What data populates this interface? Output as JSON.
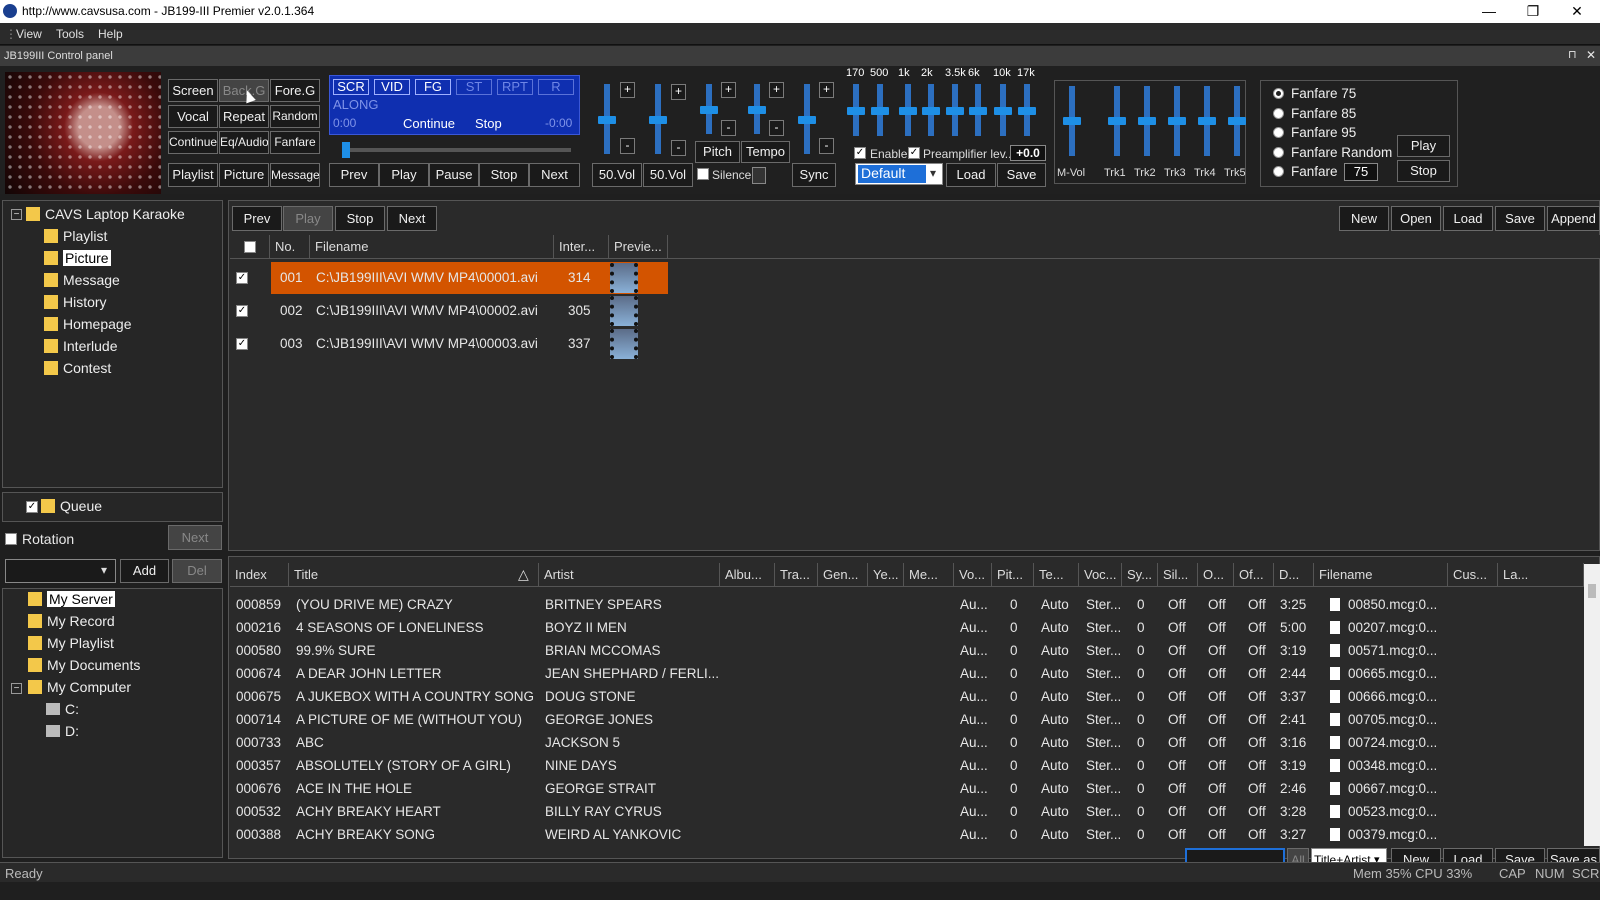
{
  "window": {
    "title": "http://www.cavsusa.com - JB199-III Premier v2.0.1.364",
    "min": "—",
    "max": "❐",
    "close": "✕"
  },
  "menu": [
    "View",
    "Tools",
    "Help"
  ],
  "panel_title": "JB199III Control panel",
  "panel_pin": "⊓",
  "panel_close": "✕",
  "ctrl_buttons": {
    "screen": "Screen",
    "backg": "Back.G",
    "foreg": "Fore.G",
    "vocal": "Vocal",
    "repeat": "Repeat",
    "random": "Random",
    "continue": "Continue",
    "eqaudio": "Eq/Audio",
    "fanfare": "Fanfare",
    "playlist": "Playlist",
    "picture": "Picture",
    "message": "Message"
  },
  "lcd": {
    "tags": [
      "SCR",
      "VID",
      "FG",
      "ST",
      "RPT",
      "R"
    ],
    "text": "ALONG",
    "time_start": "0:00",
    "continue": "Continue",
    "stop": "Stop",
    "time_end": "-0:00"
  },
  "transport": {
    "prev": "Prev",
    "play": "Play",
    "pause": "Pause",
    "stop": "Stop",
    "next": "Next"
  },
  "vol": {
    "vol1": "50.Vol",
    "vol2": "50.Vol",
    "pitch": "Pitch",
    "tempo": "Tempo",
    "silence": "Silence",
    "sync": "Sync",
    "plus": "+",
    "minus": "-"
  },
  "eq": {
    "freqs": [
      "170",
      "500",
      "1k",
      "2k",
      "3.5k",
      "6k",
      "10k",
      "17k"
    ],
    "enable": "Enable",
    "preamp": "Preamplifier lev...",
    "preamp_value": "+0.0",
    "preset": "Default",
    "load": "Load",
    "save": "Save"
  },
  "tracks": [
    "M-Vol",
    "Trk1",
    "Trk2",
    "Trk3",
    "Trk4",
    "Trk5"
  ],
  "fanfare": {
    "options": [
      "Fanfare 75",
      "Fanfare 85",
      "Fanfare 95",
      "Fanfare Random",
      "Fanfare"
    ],
    "selected": 0,
    "value": "75",
    "play": "Play",
    "stop": "Stop"
  },
  "tree": {
    "root": "CAVS Laptop Karaoke",
    "items": [
      "Playlist",
      "Picture",
      "Message",
      "History",
      "Homepage",
      "Interlude",
      "Contest"
    ],
    "selected": "Picture",
    "collapse": "−"
  },
  "queue": {
    "label": "Queue",
    "rotation": "Rotation",
    "next": "Next",
    "add": "Add",
    "del": "Del",
    "dropdown": "▾"
  },
  "tree2": {
    "items": [
      "My Server",
      "My Record",
      "My Playlist",
      "My Documents",
      "My Computer"
    ],
    "drives": [
      "C:",
      "D:"
    ],
    "selected": "My Server",
    "collapse": "−"
  },
  "picture_toolbar": {
    "prev": "Prev",
    "play": "Play",
    "stop": "Stop",
    "next": "Next",
    "new": "New",
    "open": "Open",
    "load": "Load",
    "save": "Save",
    "append": "Append"
  },
  "picture_table": {
    "headers": [
      "No.",
      "Filename",
      "Inter...",
      "Previe..."
    ],
    "rows": [
      {
        "no": "001",
        "file": "C:\\JB199III\\AVI WMV MP4\\00001.avi",
        "inter": "314"
      },
      {
        "no": "002",
        "file": "C:\\JB199III\\AVI WMV MP4\\00002.avi",
        "inter": "305"
      },
      {
        "no": "003",
        "file": "C:\\JB199III\\AVI WMV MP4\\00003.avi",
        "inter": "337"
      }
    ],
    "highlight_color": "#d35400"
  },
  "song_table": {
    "headers": [
      "Index",
      "Title",
      "Artist",
      "Albu...",
      "Tra...",
      "Gen...",
      "Ye...",
      "Me...",
      "Vo...",
      "Pit...",
      "Te...",
      "Voc...",
      "Sy...",
      "Sil...",
      "O...",
      "Of...",
      "D...",
      "Filename",
      "Cus...",
      "La..."
    ],
    "sort_arrow": "△",
    "rows": [
      [
        "000859",
        "(YOU DRIVE ME) CRAZY",
        "BRITNEY SPEARS",
        "3:25",
        "00850.mcg:0..."
      ],
      [
        "000216",
        "4 SEASONS OF LONELINESS",
        "BOYZ II MEN",
        "5:00",
        "00207.mcg:0..."
      ],
      [
        "000580",
        "99.9% SURE",
        "BRIAN MCCOMAS",
        "3:19",
        "00571.mcg:0..."
      ],
      [
        "000674",
        "A DEAR JOHN LETTER",
        "JEAN SHEPHARD / FERLI...",
        "2:44",
        "00665.mcg:0..."
      ],
      [
        "000675",
        "A JUKEBOX WITH A COUNTRY SONG",
        "DOUG STONE",
        "3:37",
        "00666.mcg:0..."
      ],
      [
        "000714",
        "A PICTURE OF ME (WITHOUT YOU)",
        "GEORGE JONES",
        "2:41",
        "00705.mcg:0..."
      ],
      [
        "000733",
        "ABC",
        "JACKSON 5",
        "3:16",
        "00724.mcg:0..."
      ],
      [
        "000357",
        "ABSOLUTELY (STORY OF A GIRL)",
        "NINE DAYS",
        "3:19",
        "00348.mcg:0..."
      ],
      [
        "000676",
        "ACE IN THE HOLE",
        "GEORGE STRAIT",
        "2:46",
        "00667.mcg:0..."
      ],
      [
        "000532",
        "ACHY BREAKY HEART",
        "BILLY RAY CYRUS",
        "3:28",
        "00523.mcg:0..."
      ],
      [
        "000388",
        "ACHY BREAKY SONG",
        "WEIRD AL YANKOVIC",
        "3:27",
        "00379.mcg:0..."
      ]
    ],
    "common": {
      "vo": "Au...",
      "pit": "0",
      "te": "Auto",
      "voc": "Ster...",
      "sy": "0",
      "sil": "Off",
      "o": "Off",
      "of": "Off"
    }
  },
  "bottom_toolbar": {
    "all": "All",
    "mode": "Title+Artist",
    "new": "New",
    "load": "Load",
    "save": "Save",
    "saveas": "Save as"
  },
  "status": {
    "ready": "Ready",
    "mem": "Mem 35% CPU 33%",
    "cap": "CAP",
    "num": "NUM",
    "scr": "SCR"
  }
}
